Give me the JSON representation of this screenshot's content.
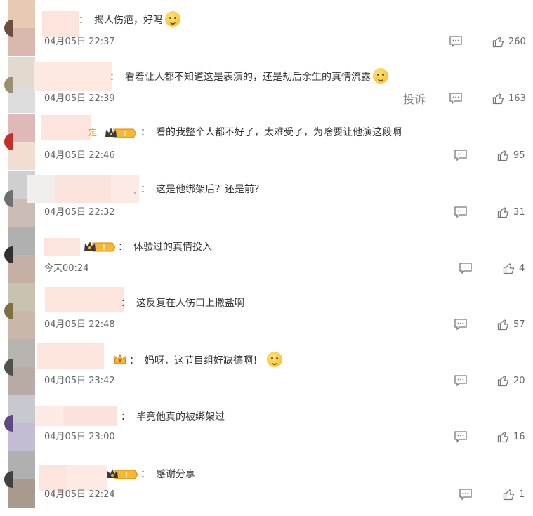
{
  "comments": [
    {
      "text": "揭人伤疤，好吗",
      "time": "04月05日 22:37",
      "likes": "260",
      "emoji": "emoji-face-icon"
    },
    {
      "text": "看着让人都不知道这是表演的，还是劫后余生的真情流露",
      "time": "04月05日 22:39",
      "likes": "163",
      "emoji": "emoji-face-icon",
      "report": "投诉"
    },
    {
      "text": "看的我整个人都不好了，太难受了，为啥要让他演这段啊",
      "time": "04月05日 22:46",
      "likes": "95",
      "partial": "定"
    },
    {
      "text": "这是他绑架后？还是前？",
      "time": "04月05日 22:32",
      "likes": "31",
      "partial": "、"
    },
    {
      "text": "体验过的真情投入",
      "time": "今天00:24",
      "likes": "4"
    },
    {
      "text": "这反复在人伤口上撒盐啊",
      "time": "04月05日 22:48",
      "likes": "57"
    },
    {
      "text": "妈呀，这节目组好缺德啊！",
      "time": "04月05日 23:42",
      "likes": "20",
      "emoji": "emoji-smile-icon"
    },
    {
      "text": "毕竟他真的被绑架过",
      "time": "04月05日 23:00",
      "likes": "16"
    },
    {
      "text": "感谢分享",
      "time": "04月05日 22:24",
      "likes": "1"
    }
  ],
  "colon": "：",
  "icons": {
    "reply": "comment-icon",
    "like": "thumbs-up-icon",
    "badge": "vip-crown-badge-icon"
  }
}
